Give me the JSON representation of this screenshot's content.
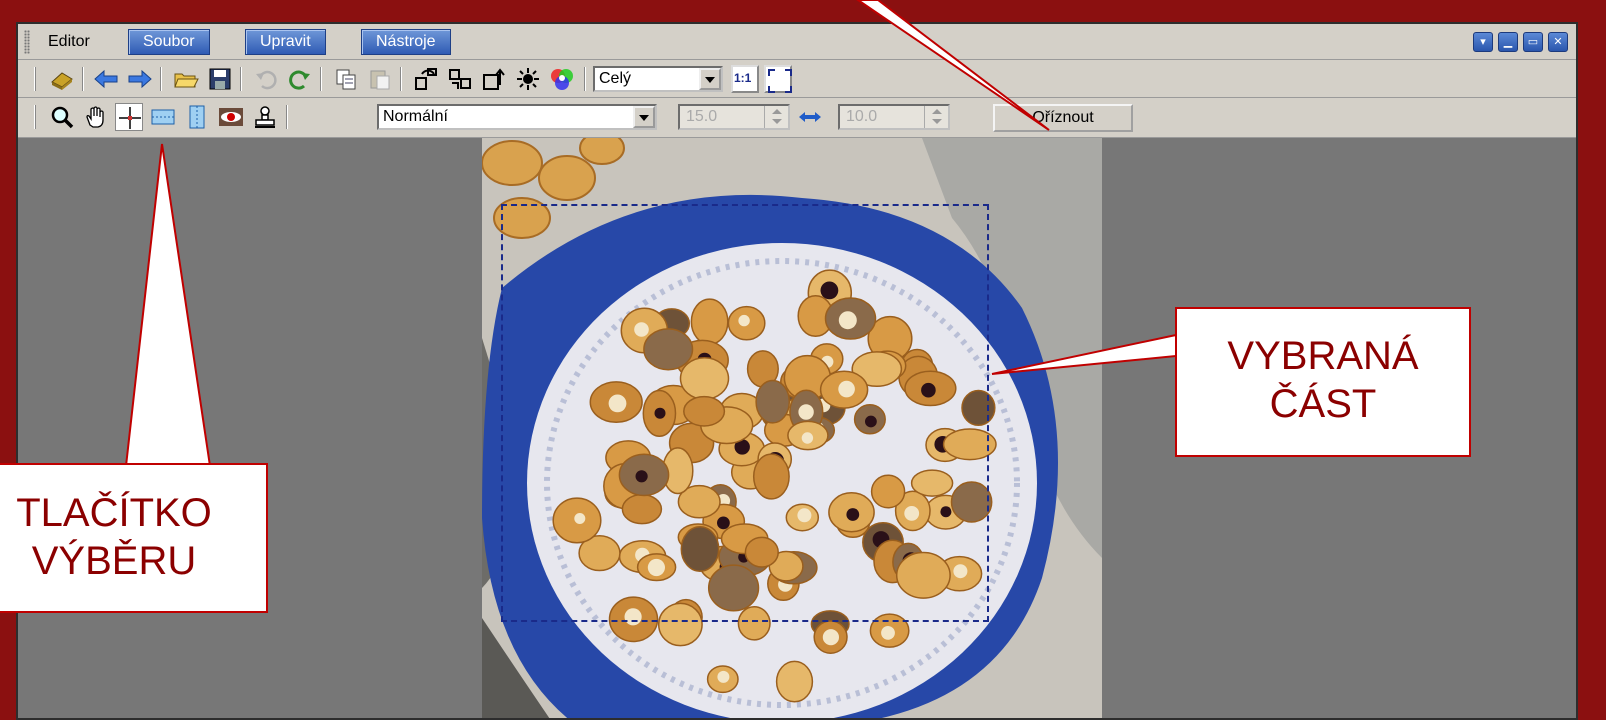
{
  "window": {
    "app_name": "Editor",
    "menu": [
      "Soubor",
      "Upravit",
      "Nástroje"
    ],
    "window_controls": [
      "collapse-icon",
      "minimize-icon",
      "restore-icon",
      "close-icon"
    ]
  },
  "toolbar1": {
    "icons": [
      "scanner-icon",
      "arrow-left-icon",
      "arrow-right-icon",
      "open-folder-icon",
      "save-icon",
      "undo-icon",
      "redo-icon",
      "copy-icon",
      "paste-icon",
      "rotate-left-icon",
      "flip-icon",
      "rotate-right-icon",
      "brightness-icon",
      "color-wheel-icon",
      "actual-size-icon",
      "fit-screen-icon"
    ],
    "zoom_select": "Celý",
    "actual_size_label": "1:1"
  },
  "toolbar2": {
    "icons": [
      "zoom-icon",
      "hand-icon",
      "crosshair-select-icon",
      "horizontal-select-icon",
      "vertical-select-icon",
      "red-eye-icon",
      "stamp-icon"
    ],
    "mode_select": "Normální",
    "width_value": "15.0",
    "height_value": "10.0",
    "crop_label": "Oříznout"
  },
  "callouts": {
    "selection": [
      "VYBRANÁ",
      "ČÁST"
    ],
    "tool": [
      "TLAČÍTKO",
      "VÝBĚRU"
    ]
  },
  "colors": {
    "frame": "#8b1010",
    "callout_border": "#c00000",
    "callout_text": "#8b0000",
    "menu_button": "#2f5bb4",
    "selection_border": "#1a2a8a"
  }
}
